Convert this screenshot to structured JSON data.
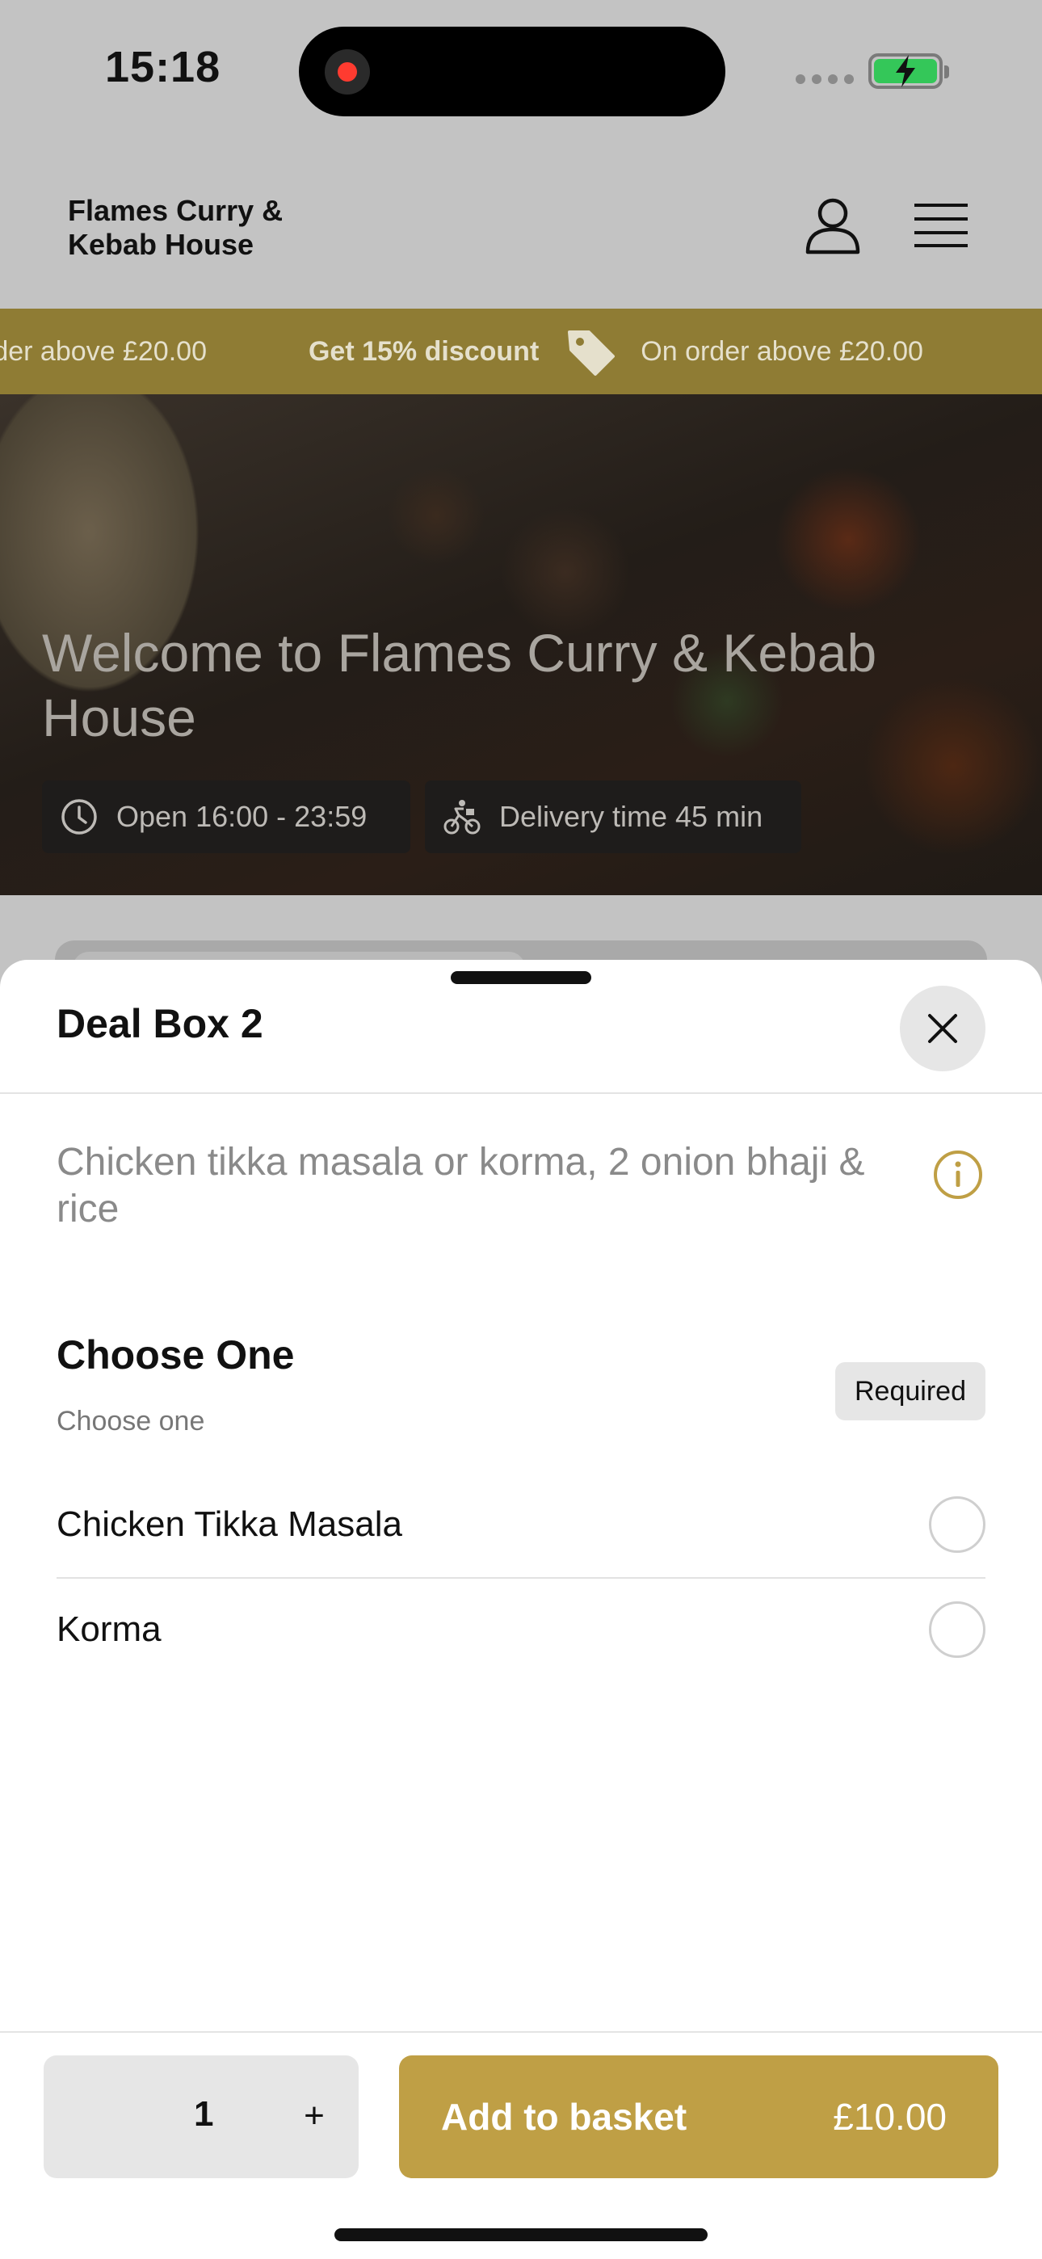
{
  "status_bar": {
    "time": "15:18"
  },
  "header": {
    "brand": "Flames Curry & Kebab House"
  },
  "promo": {
    "items": [
      {
        "discount": "",
        "condition": "rder above £20.00"
      },
      {
        "discount": "Get 15% discount",
        "condition": "On order above £20.00"
      }
    ]
  },
  "hero": {
    "title": "Welcome to Flames Curry & Kebab House",
    "open_hours": "Open 16:00 - 23:59",
    "delivery_time": "Delivery time 45 min"
  },
  "sheet": {
    "title": "Deal Box 2",
    "description": "Chicken tikka masala or korma, 2 onion bhaji & rice",
    "group": {
      "title": "Choose One",
      "subtitle": "Choose one",
      "badge": "Required",
      "options": [
        {
          "label": "Chicken Tikka Masala",
          "selected": false
        },
        {
          "label": "Korma",
          "selected": false
        }
      ]
    },
    "footer": {
      "quantity": "1",
      "plus": "+",
      "add_label": "Add to basket",
      "price": "£10.00"
    }
  },
  "colors": {
    "accent": "#bf9f45",
    "promo_bg": "#8f7c34",
    "battery": "#34c759",
    "recording": "#ff3b30"
  },
  "icons": [
    "account-icon",
    "menu-icon",
    "tag-icon",
    "clock-icon",
    "cyclist-icon",
    "close-icon",
    "info-icon"
  ]
}
